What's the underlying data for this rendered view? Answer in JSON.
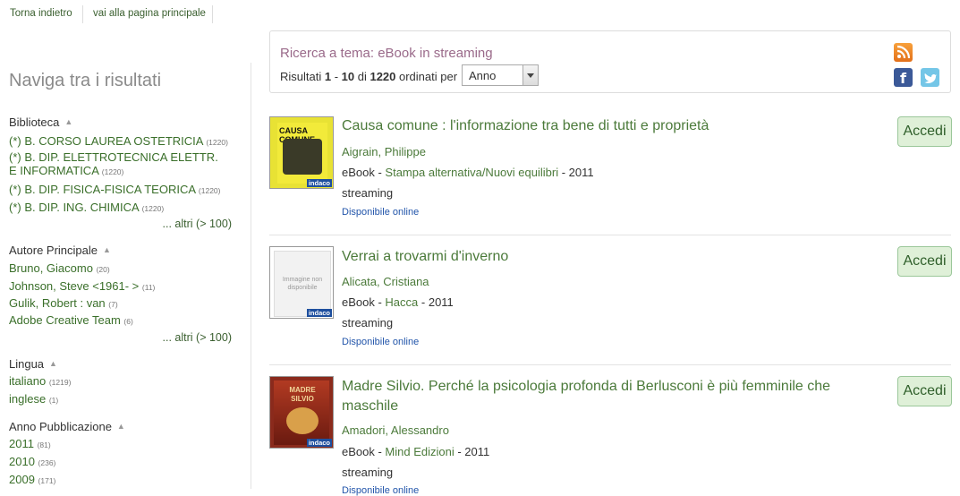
{
  "topnav": {
    "back": "Torna indietro",
    "home": "vai alla pagina principale"
  },
  "sidebar": {
    "title": "Naviga tra i risultati",
    "facets": [
      {
        "heading": "Biblioteca",
        "items": [
          {
            "label": "(*) B. CORSO LAUREA OSTETRICIA",
            "count": "(1220)"
          },
          {
            "label": "(*) B. DIP. ELETTROTECNICA ELETTR. E INFORMATICA",
            "count": "(1220)"
          },
          {
            "label": "(*) B. DIP. FISICA-FISICA TEORICA",
            "count": "(1220)"
          },
          {
            "label": "(*) B. DIP. ING. CHIMICA",
            "count": "(1220)"
          }
        ],
        "more": "... altri (> 100)"
      },
      {
        "heading": "Autore Principale",
        "items": [
          {
            "label": "Bruno, Giacomo",
            "count": "(20)"
          },
          {
            "label": "Johnson, Steve <1961- >",
            "count": "(11)"
          },
          {
            "label": "Gulik, Robert : van",
            "count": "(7)"
          },
          {
            "label": "Adobe Creative Team",
            "count": "(6)"
          }
        ],
        "more": "... altri (> 100)"
      },
      {
        "heading": "Lingua",
        "items": [
          {
            "label": "italiano",
            "count": "(1219)"
          },
          {
            "label": "inglese",
            "count": "(1)"
          }
        ]
      },
      {
        "heading": "Anno Pubblicazione",
        "items": [
          {
            "label": "2011",
            "count": "(81)"
          },
          {
            "label": "2010",
            "count": "(236)"
          },
          {
            "label": "2009",
            "count": "(171)"
          }
        ]
      }
    ]
  },
  "search": {
    "title": "Ricerca a tema: eBook in streaming",
    "results_prefix": "Risultati ",
    "from": "1",
    "dash": " - ",
    "to": "10",
    "of": " di ",
    "total": "1220",
    "ordered": " ordinati per",
    "sort_value": "Anno"
  },
  "results": [
    {
      "title": "Causa comune : l'informazione tra bene di tutti e proprietà",
      "author": "Aigrain, Philippe",
      "format": "eBook - ",
      "publisher": "Stampa alternativa/Nuovi equilibri",
      "year": " - 2011",
      "mode": "streaming",
      "availability": "Disponibile online",
      "button": "Accedi",
      "cover_text": "CAUSA COMUNE",
      "badge": "indaco"
    },
    {
      "title": "Verrai a trovarmi d'inverno",
      "author": "Alicata, Cristiana",
      "format": "eBook - ",
      "publisher": "Hacca",
      "year": " - 2011",
      "mode": "streaming",
      "availability": "Disponibile online",
      "button": "Accedi",
      "cover_text": "Immagine non disponibile",
      "badge": "indaco"
    },
    {
      "title": "Madre Silvio. Perché la psicologia profonda di Berlusconi è più femminile che maschile",
      "author": "Amadori, Alessandro",
      "format": "eBook - ",
      "publisher": "Mind Edizioni",
      "year": " - 2011",
      "mode": "streaming",
      "availability": "Disponibile online",
      "button": "Accedi",
      "cover_text": "MADRE SILVIO",
      "badge": "indaco"
    }
  ]
}
